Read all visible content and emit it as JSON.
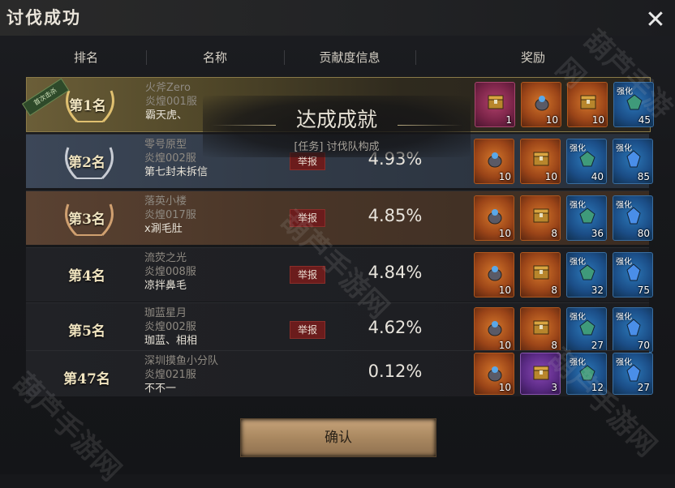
{
  "window": {
    "title": "讨伐成功"
  },
  "header": {
    "rank": "排名",
    "name": "名称",
    "contribution": "贡献度信息",
    "reward": "奖励"
  },
  "achievement": {
    "title": "达成成就",
    "subtitle": "[任务] 讨伐队构成"
  },
  "rows": [
    {
      "rank": "第1名",
      "ribbon": "首次击杀",
      "name": "火斧Zero",
      "server": "炎煌001服",
      "guild": "霸天虎、",
      "report": "",
      "percent": "",
      "rewards": [
        {
          "color": "pink",
          "icon": "chest-icon",
          "qty": "1",
          "tag": ""
        },
        {
          "color": "orange",
          "icon": "pouch-icon",
          "qty": "10",
          "tag": ""
        },
        {
          "color": "orange",
          "icon": "chest-icon",
          "qty": "10",
          "tag": ""
        },
        {
          "color": "blue",
          "icon": "gem-icon",
          "qty": "45",
          "tag": "强化"
        }
      ]
    },
    {
      "rank": "第2名",
      "name": "零号原型",
      "server": "炎煌002服",
      "guild": "第七封未拆信",
      "report": "举报",
      "percent": "4.93%",
      "rewards": [
        {
          "color": "orange",
          "icon": "pouch-icon",
          "qty": "10",
          "tag": ""
        },
        {
          "color": "orange",
          "icon": "chest-icon",
          "qty": "10",
          "tag": ""
        },
        {
          "color": "blue",
          "icon": "gem-icon",
          "qty": "40",
          "tag": "强化"
        },
        {
          "color": "blue",
          "icon": "crystal-icon",
          "qty": "85",
          "tag": "强化"
        }
      ]
    },
    {
      "rank": "第3名",
      "name": "落英小楼",
      "server": "炎煌017服",
      "guild": "x涮毛肚",
      "report": "举报",
      "percent": "4.85%",
      "rewards": [
        {
          "color": "orange",
          "icon": "pouch-icon",
          "qty": "10",
          "tag": ""
        },
        {
          "color": "orange",
          "icon": "chest-icon",
          "qty": "8",
          "tag": ""
        },
        {
          "color": "blue",
          "icon": "gem-icon",
          "qty": "36",
          "tag": "强化"
        },
        {
          "color": "blue",
          "icon": "crystal-icon",
          "qty": "80",
          "tag": "强化"
        }
      ]
    },
    {
      "rank": "第4名",
      "name": "流荧之光",
      "server": "炎煌008服",
      "guild": "凉拌鼻毛",
      "report": "举报",
      "percent": "4.84%",
      "rewards": [
        {
          "color": "orange",
          "icon": "pouch-icon",
          "qty": "10",
          "tag": ""
        },
        {
          "color": "orange",
          "icon": "chest-icon",
          "qty": "8",
          "tag": ""
        },
        {
          "color": "blue",
          "icon": "gem-icon",
          "qty": "32",
          "tag": "强化"
        },
        {
          "color": "blue",
          "icon": "crystal-icon",
          "qty": "75",
          "tag": "强化"
        }
      ]
    },
    {
      "rank": "第5名",
      "name": "珈蓝星月",
      "server": "炎煌002服",
      "guild": "珈蓝、相相",
      "report": "举报",
      "percent": "4.62%",
      "rewards": [
        {
          "color": "orange",
          "icon": "pouch-icon",
          "qty": "10",
          "tag": ""
        },
        {
          "color": "orange",
          "icon": "chest-icon",
          "qty": "8",
          "tag": ""
        },
        {
          "color": "blue",
          "icon": "gem-icon",
          "qty": "27",
          "tag": "强化"
        },
        {
          "color": "blue",
          "icon": "crystal-icon",
          "qty": "70",
          "tag": "强化"
        }
      ]
    },
    {
      "rank": "第47名",
      "name": "深圳摸鱼小分队",
      "server": "炎煌021服",
      "guild": "不不一",
      "report": "",
      "percent": "0.12%",
      "rewards": [
        {
          "color": "orange",
          "icon": "pouch-icon",
          "qty": "10",
          "tag": ""
        },
        {
          "color": "purple",
          "icon": "chest-icon",
          "qty": "3",
          "tag": ""
        },
        {
          "color": "blue",
          "icon": "gem-icon",
          "qty": "12",
          "tag": "强化"
        },
        {
          "color": "blue",
          "icon": "crystal-icon",
          "qty": "27",
          "tag": "强化"
        }
      ]
    }
  ],
  "confirm_label": "确认",
  "watermark": "葫芦手游网"
}
